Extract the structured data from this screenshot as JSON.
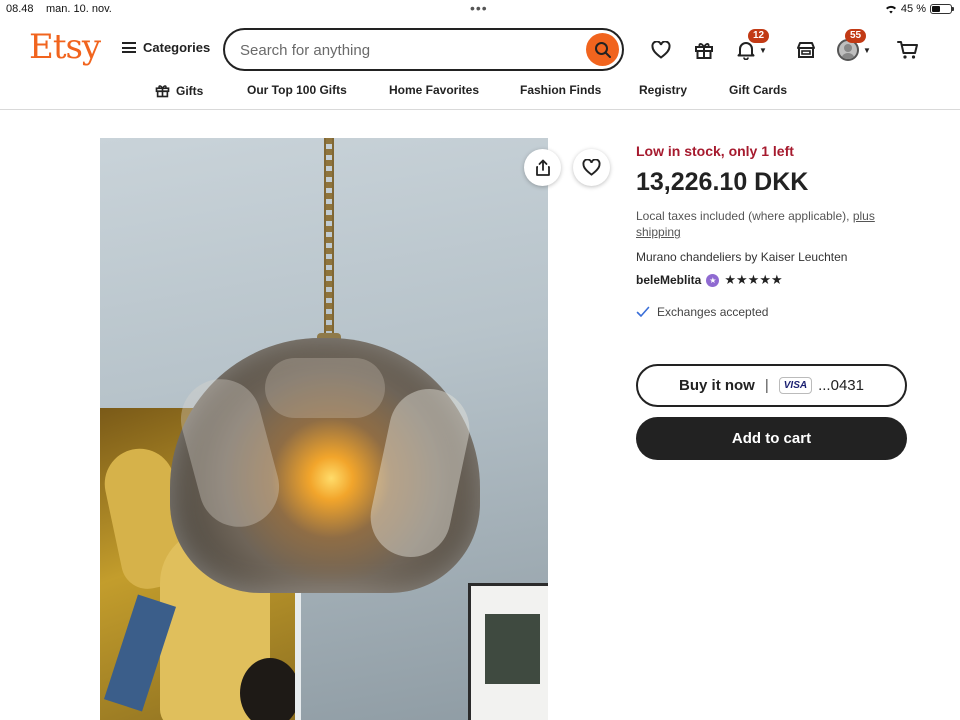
{
  "status_bar": {
    "time": "08.48",
    "date": "man. 10. nov.",
    "battery_text": "45 %",
    "battery_level": 0.45
  },
  "header": {
    "logo": "Etsy",
    "categories_label": "Categories",
    "search_placeholder": "Search for anything",
    "notifications_count": "12",
    "account_count": "55",
    "accent_color": "#f1641e"
  },
  "nav": {
    "items": [
      {
        "label": "Gifts",
        "icon": "gift-icon"
      },
      {
        "label": "Our Top 100 Gifts"
      },
      {
        "label": "Home Favorites"
      },
      {
        "label": "Fashion Finds"
      },
      {
        "label": "Registry"
      },
      {
        "label": "Gift Cards"
      }
    ]
  },
  "product": {
    "image_alt": "Murano glass pendant lamp",
    "stock_text": "Low in stock, only 1 left",
    "price": "13,226.10 DKK",
    "tax_text": "Local taxes included (where applicable),",
    "tax_link": "plus shipping",
    "title": "Murano chandeliers by Kaiser Leuchten",
    "seller_name": "beleMeblita",
    "rating_stars": 5,
    "stars_text": "★★★★★",
    "exchanges_text": "Exchanges accepted",
    "buy_now_label": "Buy it now",
    "card_brand": "VISA",
    "card_suffix": "...0431",
    "add_to_cart_label": "Add to cart",
    "stock_color": "#a61a2e"
  }
}
